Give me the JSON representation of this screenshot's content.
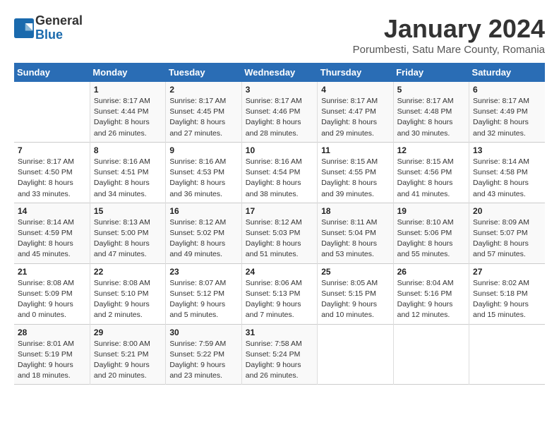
{
  "logo": {
    "general": "General",
    "blue": "Blue"
  },
  "title": "January 2024",
  "subtitle": "Porumbesti, Satu Mare County, Romania",
  "days_of_week": [
    "Sunday",
    "Monday",
    "Tuesday",
    "Wednesday",
    "Thursday",
    "Friday",
    "Saturday"
  ],
  "weeks": [
    [
      {
        "day": "",
        "info": ""
      },
      {
        "day": "1",
        "info": "Sunrise: 8:17 AM\nSunset: 4:44 PM\nDaylight: 8 hours\nand 26 minutes."
      },
      {
        "day": "2",
        "info": "Sunrise: 8:17 AM\nSunset: 4:45 PM\nDaylight: 8 hours\nand 27 minutes."
      },
      {
        "day": "3",
        "info": "Sunrise: 8:17 AM\nSunset: 4:46 PM\nDaylight: 8 hours\nand 28 minutes."
      },
      {
        "day": "4",
        "info": "Sunrise: 8:17 AM\nSunset: 4:47 PM\nDaylight: 8 hours\nand 29 minutes."
      },
      {
        "day": "5",
        "info": "Sunrise: 8:17 AM\nSunset: 4:48 PM\nDaylight: 8 hours\nand 30 minutes."
      },
      {
        "day": "6",
        "info": "Sunrise: 8:17 AM\nSunset: 4:49 PM\nDaylight: 8 hours\nand 32 minutes."
      }
    ],
    [
      {
        "day": "7",
        "info": "Sunrise: 8:17 AM\nSunset: 4:50 PM\nDaylight: 8 hours\nand 33 minutes."
      },
      {
        "day": "8",
        "info": "Sunrise: 8:16 AM\nSunset: 4:51 PM\nDaylight: 8 hours\nand 34 minutes."
      },
      {
        "day": "9",
        "info": "Sunrise: 8:16 AM\nSunset: 4:53 PM\nDaylight: 8 hours\nand 36 minutes."
      },
      {
        "day": "10",
        "info": "Sunrise: 8:16 AM\nSunset: 4:54 PM\nDaylight: 8 hours\nand 38 minutes."
      },
      {
        "day": "11",
        "info": "Sunrise: 8:15 AM\nSunset: 4:55 PM\nDaylight: 8 hours\nand 39 minutes."
      },
      {
        "day": "12",
        "info": "Sunrise: 8:15 AM\nSunset: 4:56 PM\nDaylight: 8 hours\nand 41 minutes."
      },
      {
        "day": "13",
        "info": "Sunrise: 8:14 AM\nSunset: 4:58 PM\nDaylight: 8 hours\nand 43 minutes."
      }
    ],
    [
      {
        "day": "14",
        "info": "Sunrise: 8:14 AM\nSunset: 4:59 PM\nDaylight: 8 hours\nand 45 minutes."
      },
      {
        "day": "15",
        "info": "Sunrise: 8:13 AM\nSunset: 5:00 PM\nDaylight: 8 hours\nand 47 minutes."
      },
      {
        "day": "16",
        "info": "Sunrise: 8:12 AM\nSunset: 5:02 PM\nDaylight: 8 hours\nand 49 minutes."
      },
      {
        "day": "17",
        "info": "Sunrise: 8:12 AM\nSunset: 5:03 PM\nDaylight: 8 hours\nand 51 minutes."
      },
      {
        "day": "18",
        "info": "Sunrise: 8:11 AM\nSunset: 5:04 PM\nDaylight: 8 hours\nand 53 minutes."
      },
      {
        "day": "19",
        "info": "Sunrise: 8:10 AM\nSunset: 5:06 PM\nDaylight: 8 hours\nand 55 minutes."
      },
      {
        "day": "20",
        "info": "Sunrise: 8:09 AM\nSunset: 5:07 PM\nDaylight: 8 hours\nand 57 minutes."
      }
    ],
    [
      {
        "day": "21",
        "info": "Sunrise: 8:08 AM\nSunset: 5:09 PM\nDaylight: 9 hours\nand 0 minutes."
      },
      {
        "day": "22",
        "info": "Sunrise: 8:08 AM\nSunset: 5:10 PM\nDaylight: 9 hours\nand 2 minutes."
      },
      {
        "day": "23",
        "info": "Sunrise: 8:07 AM\nSunset: 5:12 PM\nDaylight: 9 hours\nand 5 minutes."
      },
      {
        "day": "24",
        "info": "Sunrise: 8:06 AM\nSunset: 5:13 PM\nDaylight: 9 hours\nand 7 minutes."
      },
      {
        "day": "25",
        "info": "Sunrise: 8:05 AM\nSunset: 5:15 PM\nDaylight: 9 hours\nand 10 minutes."
      },
      {
        "day": "26",
        "info": "Sunrise: 8:04 AM\nSunset: 5:16 PM\nDaylight: 9 hours\nand 12 minutes."
      },
      {
        "day": "27",
        "info": "Sunrise: 8:02 AM\nSunset: 5:18 PM\nDaylight: 9 hours\nand 15 minutes."
      }
    ],
    [
      {
        "day": "28",
        "info": "Sunrise: 8:01 AM\nSunset: 5:19 PM\nDaylight: 9 hours\nand 18 minutes."
      },
      {
        "day": "29",
        "info": "Sunrise: 8:00 AM\nSunset: 5:21 PM\nDaylight: 9 hours\nand 20 minutes."
      },
      {
        "day": "30",
        "info": "Sunrise: 7:59 AM\nSunset: 5:22 PM\nDaylight: 9 hours\nand 23 minutes."
      },
      {
        "day": "31",
        "info": "Sunrise: 7:58 AM\nSunset: 5:24 PM\nDaylight: 9 hours\nand 26 minutes."
      },
      {
        "day": "",
        "info": ""
      },
      {
        "day": "",
        "info": ""
      },
      {
        "day": "",
        "info": ""
      }
    ]
  ]
}
